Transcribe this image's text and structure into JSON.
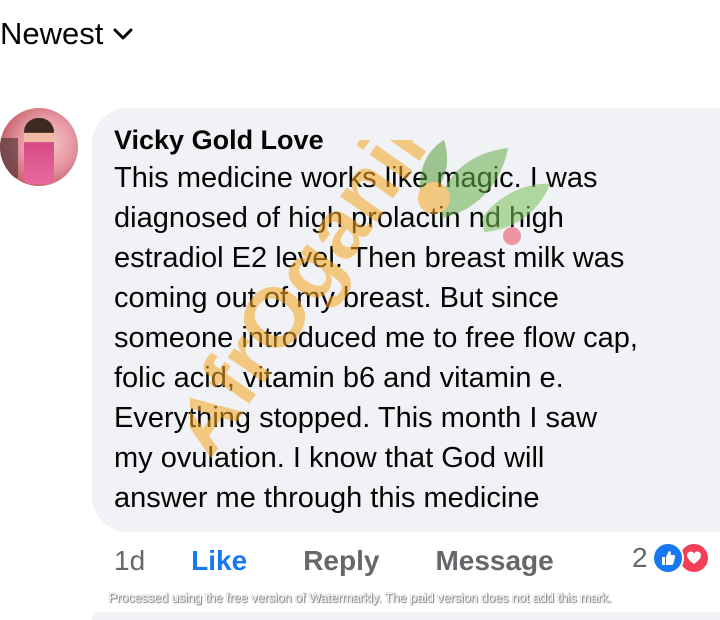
{
  "sort": {
    "label": "Newest",
    "icon": "chevron-down-icon"
  },
  "comment": {
    "author": "Vicky Gold Love",
    "lines": [
      "This medicine works like magic. I was",
      "diagnosed of high prolactin nd high",
      "estradiol E2 level. Then breast milk was",
      "coming out of my breast. But since",
      "someone introduced me to free flow cap,",
      "folic acid, vitamin b6 and vitamin e.",
      "Everything stopped. This month I saw",
      "my ovulation. I know that God will",
      "answer me through this medicine"
    ]
  },
  "actions": {
    "time": "1d",
    "like": "Like",
    "reply": "Reply",
    "message": "Message"
  },
  "reactions": {
    "count": "2",
    "icons": [
      "like-reaction-icon",
      "love-reaction-icon"
    ]
  },
  "watermark": {
    "brand": "AfrOganiks"
  },
  "processed_note": "Processed using the free version of Watermarkly. The paid version does not add this mark.",
  "colors": {
    "bubble": "#f0f2f5",
    "like_blue": "#1877f2",
    "love_red": "#f33e58",
    "muted": "#65676b",
    "watermark_orange": "#f5a623",
    "watermark_green": "#6ab04c"
  }
}
